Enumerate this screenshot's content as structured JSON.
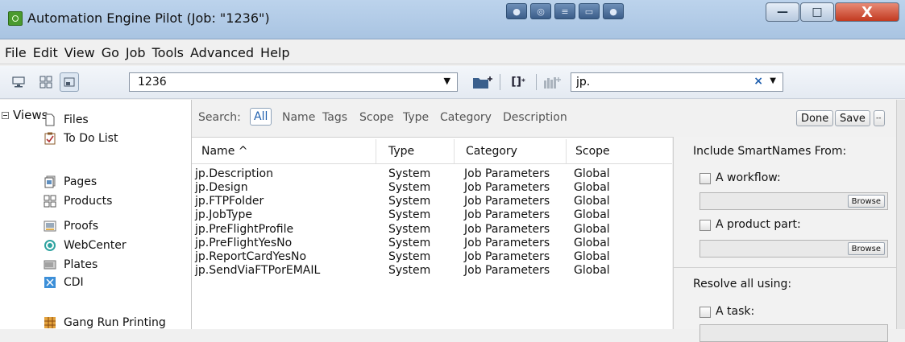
{
  "window": {
    "title": "Automation Engine Pilot (Job: \"1236\")",
    "close_glyph": "X",
    "minimize_glyph": "—",
    "maximize_glyph": "□"
  },
  "menu": [
    "File",
    "Edit",
    "View",
    "Go",
    "Job",
    "Tools",
    "Advanced",
    "Help"
  ],
  "toolbar": {
    "job_value": "1236",
    "search_value": "jp.",
    "clear_glyph": "×"
  },
  "sidebar": {
    "heading": "Views",
    "items": [
      {
        "label": "Files",
        "icon": "file-icon"
      },
      {
        "label": "To Do List",
        "icon": "todo-check-icon"
      },
      {
        "label": "Pages",
        "icon": "pages-icon"
      },
      {
        "label": "Products",
        "icon": "products-icon"
      },
      {
        "label": "Proofs",
        "icon": "proofs-icon"
      },
      {
        "label": "WebCenter",
        "icon": "webcenter-icon"
      },
      {
        "label": "Plates",
        "icon": "plates-icon"
      },
      {
        "label": "CDI",
        "icon": "cdi-icon"
      },
      {
        "label": "Gang Run Printing",
        "icon": "gang-run-icon"
      }
    ]
  },
  "search": {
    "label": "Search:",
    "scopes": [
      "All",
      "Name",
      "Tags",
      "Scope",
      "Type",
      "Category",
      "Description"
    ],
    "done_label": "Done",
    "save_label": "Save",
    "more_label": "--"
  },
  "table": {
    "columns": [
      "Name ^",
      "Type",
      "Category",
      "Scope"
    ],
    "rows": [
      [
        "jp.Description",
        "System",
        "Job Parameters",
        "Global"
      ],
      [
        "jp.Design",
        "System",
        "Job Parameters",
        "Global"
      ],
      [
        "jp.FTPFolder",
        "System",
        "Job Parameters",
        "Global"
      ],
      [
        "jp.JobType",
        "System",
        "Job Parameters",
        "Global"
      ],
      [
        "jp.PreFlightProfile",
        "System",
        "Job Parameters",
        "Global"
      ],
      [
        "jp.PreFlightYesNo",
        "System",
        "Job Parameters",
        "Global"
      ],
      [
        "jp.ReportCardYesNo",
        "System",
        "Job Parameters",
        "Global"
      ],
      [
        "jp.SendViaFTPorEMAIL",
        "System",
        "Job Parameters",
        "Global"
      ]
    ]
  },
  "right_panel": {
    "include_heading": "Include SmartNames From:",
    "workflow_label": "A workflow:",
    "product_part_label": "A product part:",
    "browse_label": "Browse",
    "resolve_heading": "Resolve all using:",
    "task_label": "A task:"
  },
  "colors": {
    "titlebar": "#b6cde8",
    "close": "#c9452a",
    "link_blue": "#1f5fae"
  }
}
